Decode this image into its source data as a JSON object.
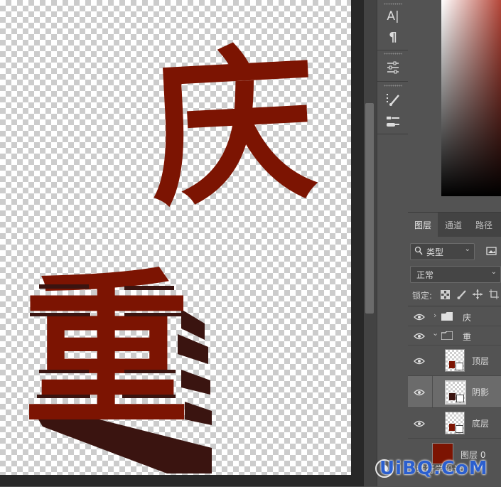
{
  "canvas": {
    "glyph_top": "庆",
    "glyph_bottom": "重",
    "glyph_color": "#7c1402",
    "shadow_color": "#3a1410"
  },
  "tools": [
    {
      "name": "character-panel-icon",
      "label": "A|"
    },
    {
      "name": "paragraph-panel-icon",
      "label": "¶"
    },
    {
      "name": "adjustments-icon"
    },
    {
      "name": "brush-settings-icon"
    },
    {
      "name": "clone-source-icon"
    }
  ],
  "layers_panel": {
    "tabs": [
      "图层",
      "通道",
      "路径"
    ],
    "active_tab": 0,
    "filter_label": "类型",
    "blend_mode": "正常",
    "lock_label": "锁定:",
    "layers": [
      {
        "name": "庆",
        "type": "group",
        "expanded": false
      },
      {
        "name": "重",
        "type": "group",
        "expanded": true
      },
      {
        "name": "顶层",
        "type": "layer"
      },
      {
        "name": "阴影",
        "type": "layer",
        "selected": true
      },
      {
        "name": "底层",
        "type": "layer"
      },
      {
        "name": "图层 0",
        "type": "fill"
      }
    ]
  },
  "watermark": {
    "text": "UiBQ.CoM",
    "sub": "转行学设计"
  }
}
